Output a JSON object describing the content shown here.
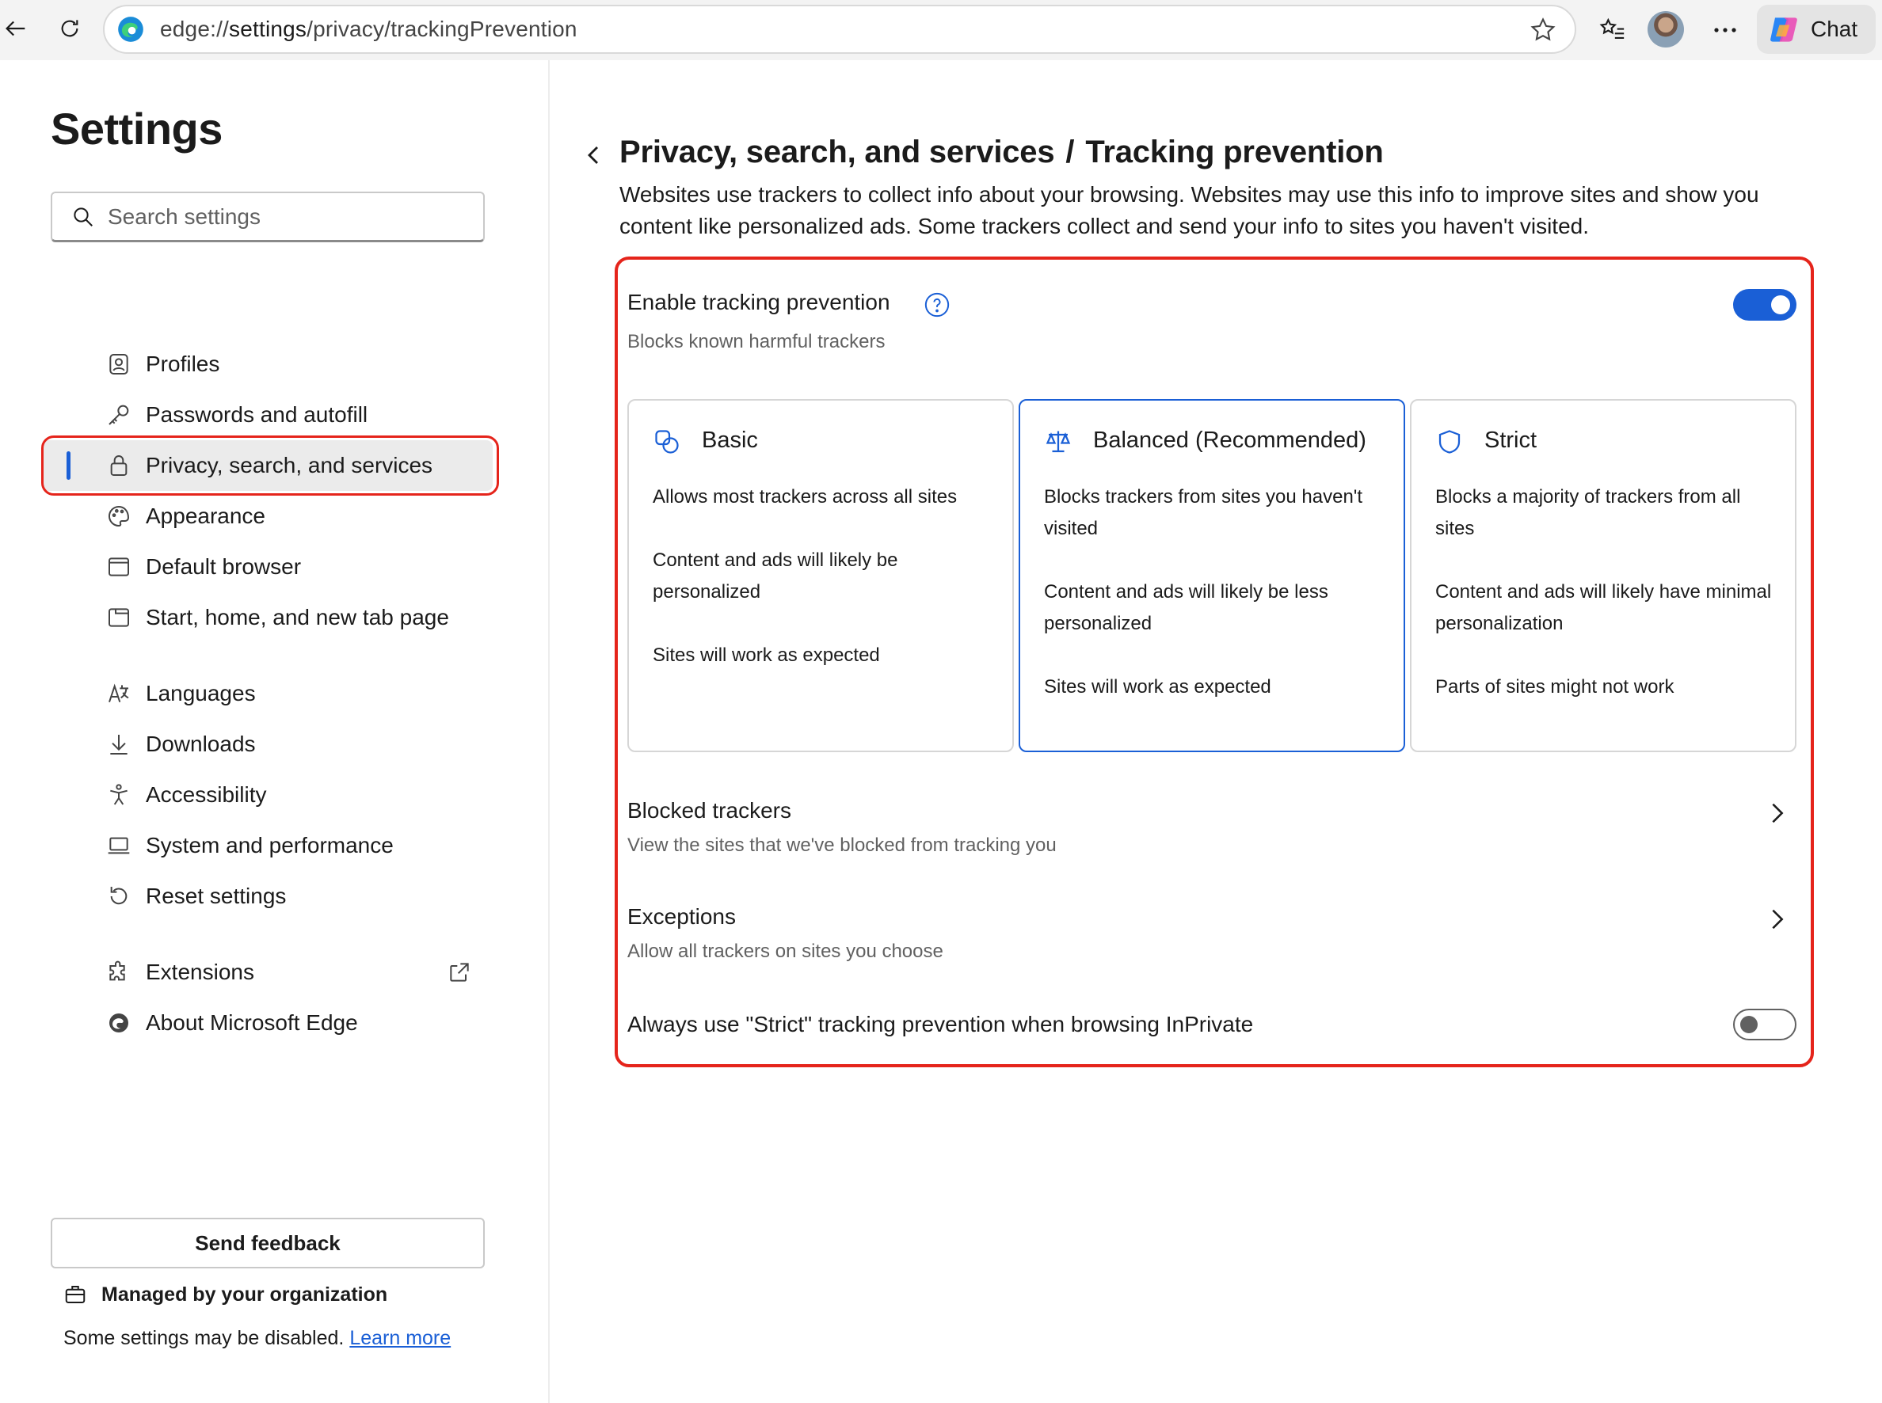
{
  "browser": {
    "url_prefix": "edge://",
    "url_host": "settings",
    "url_path": "/privacy/trackingPrevention",
    "chat_label": "Chat"
  },
  "sidebar": {
    "title": "Settings",
    "search_placeholder": "Search settings",
    "items": [
      {
        "label": "Profiles",
        "icon": "profiles-icon"
      },
      {
        "label": "Passwords and autofill",
        "icon": "key-icon"
      },
      {
        "label": "Privacy, search, and services",
        "icon": "lock-icon",
        "active": true
      },
      {
        "label": "Appearance",
        "icon": "palette-icon"
      },
      {
        "label": "Default browser",
        "icon": "browser-icon"
      },
      {
        "label": "Start, home, and new tab page",
        "icon": "home-tab-icon"
      },
      {
        "label": "Languages",
        "icon": "languages-icon"
      },
      {
        "label": "Downloads",
        "icon": "download-icon"
      },
      {
        "label": "Accessibility",
        "icon": "accessibility-icon"
      },
      {
        "label": "System and performance",
        "icon": "laptop-icon"
      },
      {
        "label": "Reset settings",
        "icon": "reset-icon"
      },
      {
        "label": "Extensions",
        "icon": "puzzle-icon"
      },
      {
        "label": "About Microsoft Edge",
        "icon": "edge-icon"
      }
    ],
    "feedback_label": "Send feedback",
    "managed_label": "Managed by your organization",
    "disabled_note": "Some settings may be disabled.",
    "learn_more": "Learn more"
  },
  "main": {
    "breadcrumb_parent": "Privacy, search, and services",
    "breadcrumb_sep": "/",
    "breadcrumb_current": "Tracking prevention",
    "description": "Websites use trackers to collect info about your browsing. Websites may use this info to improve sites and show you content like personalized ads. Some trackers collect and send your info to sites you haven't visited.",
    "enable": {
      "title": "Enable tracking prevention",
      "subtitle": "Blocks known harmful trackers",
      "enabled": true
    },
    "levels": [
      {
        "name": "Basic",
        "icon": "basic-shapes-icon",
        "lines": [
          "Allows most trackers across all sites",
          "Content and ads will likely be personalized",
          "Sites will work as expected"
        ]
      },
      {
        "name": "Balanced (Recommended)",
        "icon": "scales-icon",
        "selected": true,
        "lines": [
          "Blocks trackers from sites you haven't visited",
          "Content and ads will likely be less personalized",
          "Sites will work as expected"
        ]
      },
      {
        "name": "Strict",
        "icon": "shield-icon",
        "lines": [
          "Blocks a majority of trackers from all sites",
          "Content and ads will likely have minimal personalization",
          "Parts of sites might not work"
        ]
      }
    ],
    "blocked": {
      "title": "Blocked trackers",
      "subtitle": "View the sites that we've blocked from tracking you"
    },
    "exceptions": {
      "title": "Exceptions",
      "subtitle": "Allow all trackers on sites you choose"
    },
    "inprivate": {
      "title": "Always use \"Strict\" tracking prevention when browsing InPrivate",
      "enabled": false
    }
  },
  "colors": {
    "accent": "#1a5fd6",
    "highlight_outline": "#e5241b"
  }
}
